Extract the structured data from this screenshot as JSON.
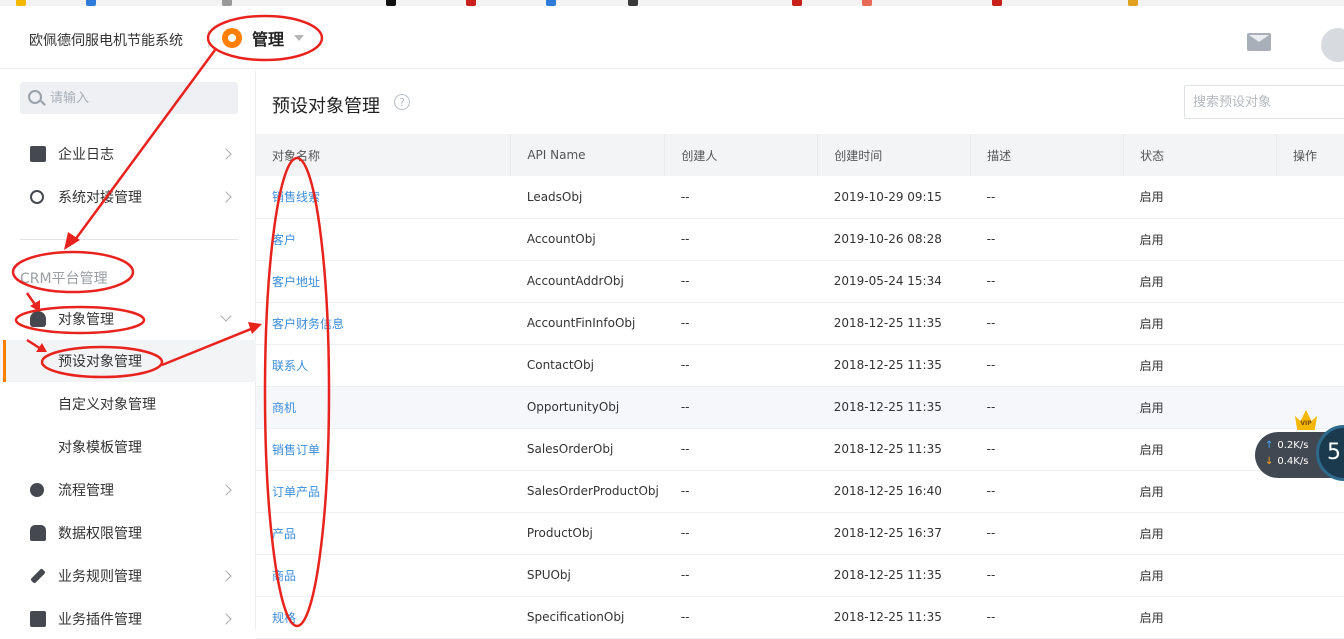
{
  "app": {
    "title": "欧佩德伺服电机节能系统",
    "module_label": "管理"
  },
  "sidebar": {
    "search_placeholder": "请输入",
    "items_top": [
      {
        "label": "企业日志"
      },
      {
        "label": "系统对接管理"
      }
    ],
    "section_title": "CRM平台管理",
    "object_group": {
      "label": "对象管理"
    },
    "sub_items": [
      {
        "label": "预设对象管理"
      },
      {
        "label": "自定义对象管理"
      },
      {
        "label": "对象模板管理"
      }
    ],
    "items_bottom": [
      {
        "label": "流程管理"
      },
      {
        "label": "数据权限管理"
      },
      {
        "label": "业务规则管理"
      },
      {
        "label": "业务插件管理"
      }
    ]
  },
  "main": {
    "page_title": "预设对象管理",
    "help_glyph": "?",
    "search_placeholder": "搜索预设对象",
    "columns": [
      "对象名称",
      "API Name",
      "创建人",
      "创建时间",
      "描述",
      "状态",
      "操作"
    ],
    "rows": [
      {
        "name": "销售线索",
        "api": "LeadsObj",
        "creator": "--",
        "time": "2019-10-29 09:15",
        "desc": "--",
        "status": "启用"
      },
      {
        "name": "客户",
        "api": "AccountObj",
        "creator": "--",
        "time": "2019-10-26 08:28",
        "desc": "--",
        "status": "启用"
      },
      {
        "name": "客户地址",
        "api": "AccountAddrObj",
        "creator": "--",
        "time": "2019-05-24 15:34",
        "desc": "--",
        "status": "启用"
      },
      {
        "name": "客户财务信息",
        "api": "AccountFinInfoObj",
        "creator": "--",
        "time": "2018-12-25 11:35",
        "desc": "--",
        "status": "启用"
      },
      {
        "name": "联系人",
        "api": "ContactObj",
        "creator": "--",
        "time": "2018-12-25 11:35",
        "desc": "--",
        "status": "启用"
      },
      {
        "name": "商机",
        "api": "OpportunityObj",
        "creator": "--",
        "time": "2018-12-25 11:35",
        "desc": "--",
        "status": "启用"
      },
      {
        "name": "销售订单",
        "api": "SalesOrderObj",
        "creator": "--",
        "time": "2018-12-25 11:35",
        "desc": "--",
        "status": "启用"
      },
      {
        "name": "订单产品",
        "api": "SalesOrderProductObj",
        "creator": "--",
        "time": "2018-12-25 16:40",
        "desc": "--",
        "status": "启用"
      },
      {
        "name": "产品",
        "api": "ProductObj",
        "creator": "--",
        "time": "2018-12-25 16:37",
        "desc": "--",
        "status": "启用"
      },
      {
        "name": "商品",
        "api": "SPUObj",
        "creator": "--",
        "time": "2018-12-25 11:35",
        "desc": "--",
        "status": "启用"
      },
      {
        "name": "规格",
        "api": "SpecificationObj",
        "creator": "--",
        "time": "2018-12-25 11:35",
        "desc": "--",
        "status": "启用"
      }
    ]
  },
  "net_widget": {
    "up_arrow": "↑",
    "down_arrow": "↓",
    "up_speed": "0.2K/s",
    "down_speed": "0.4K/s",
    "ball_text": "5",
    "vip_text": "VIP"
  },
  "colors": {
    "accent": "#ff8000",
    "link": "#3c8ddc",
    "annotation": "#e8231e"
  }
}
